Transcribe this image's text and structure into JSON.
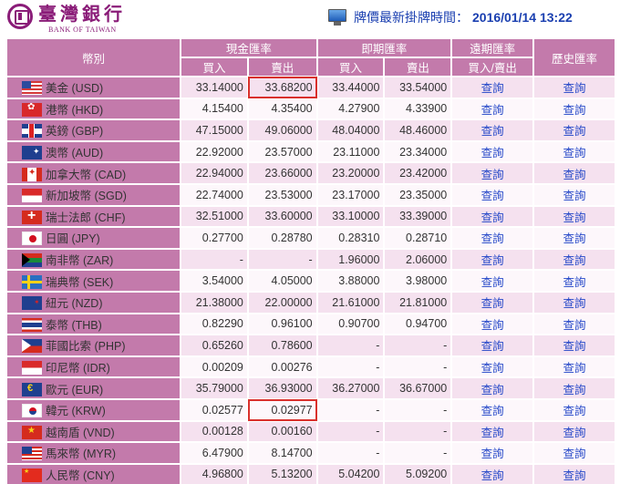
{
  "bank": {
    "name_zh": "臺灣銀行",
    "name_en": "BANK OF TAIWAN"
  },
  "update": {
    "icon": "monitor-icon",
    "label": "牌價最新掛牌時間：",
    "time": "2016/01/14 13:22"
  },
  "table": {
    "headers": {
      "currency": "幣別",
      "cash": "現金匯率",
      "spot": "即期匯率",
      "forward": "遠期匯率",
      "history": "歷史匯率",
      "buy": "買入",
      "sell": "賣出",
      "buy_sell": "買入/賣出"
    },
    "link_label": "查詢",
    "rows": [
      {
        "flag": "usd",
        "currency": "美金 (USD)",
        "cash_buy": "33.14000",
        "cash_sell": "33.68200",
        "spot_buy": "33.44000",
        "spot_sell": "33.54000"
      },
      {
        "flag": "hkd",
        "currency": "港幣 (HKD)",
        "cash_buy": "4.15400",
        "cash_sell": "4.35400",
        "spot_buy": "4.27900",
        "spot_sell": "4.33900"
      },
      {
        "flag": "gbp",
        "currency": "英鎊 (GBP)",
        "cash_buy": "47.15000",
        "cash_sell": "49.06000",
        "spot_buy": "48.04000",
        "spot_sell": "48.46000"
      },
      {
        "flag": "aud",
        "currency": "澳幣 (AUD)",
        "cash_buy": "22.92000",
        "cash_sell": "23.57000",
        "spot_buy": "23.11000",
        "spot_sell": "23.34000"
      },
      {
        "flag": "cad",
        "currency": "加拿大幣 (CAD)",
        "cash_buy": "22.94000",
        "cash_sell": "23.66000",
        "spot_buy": "23.20000",
        "spot_sell": "23.42000"
      },
      {
        "flag": "sgd",
        "currency": "新加坡幣 (SGD)",
        "cash_buy": "22.74000",
        "cash_sell": "23.53000",
        "spot_buy": "23.17000",
        "spot_sell": "23.35000"
      },
      {
        "flag": "chf",
        "currency": "瑞士法郎 (CHF)",
        "cash_buy": "32.51000",
        "cash_sell": "33.60000",
        "spot_buy": "33.10000",
        "spot_sell": "33.39000"
      },
      {
        "flag": "jpy",
        "currency": "日圓 (JPY)",
        "cash_buy": "0.27700",
        "cash_sell": "0.28780",
        "spot_buy": "0.28310",
        "spot_sell": "0.28710"
      },
      {
        "flag": "zar",
        "currency": "南非幣 (ZAR)",
        "cash_buy": "-",
        "cash_sell": "-",
        "spot_buy": "1.96000",
        "spot_sell": "2.06000"
      },
      {
        "flag": "sek",
        "currency": "瑞典幣 (SEK)",
        "cash_buy": "3.54000",
        "cash_sell": "4.05000",
        "spot_buy": "3.88000",
        "spot_sell": "3.98000"
      },
      {
        "flag": "nzd",
        "currency": "紐元 (NZD)",
        "cash_buy": "21.38000",
        "cash_sell": "22.00000",
        "spot_buy": "21.61000",
        "spot_sell": "21.81000"
      },
      {
        "flag": "thb",
        "currency": "泰幣 (THB)",
        "cash_buy": "0.82290",
        "cash_sell": "0.96100",
        "spot_buy": "0.90700",
        "spot_sell": "0.94700"
      },
      {
        "flag": "php",
        "currency": "菲國比索 (PHP)",
        "cash_buy": "0.65260",
        "cash_sell": "0.78600",
        "spot_buy": "-",
        "spot_sell": "-"
      },
      {
        "flag": "idr",
        "currency": "印尼幣 (IDR)",
        "cash_buy": "0.00209",
        "cash_sell": "0.00276",
        "spot_buy": "-",
        "spot_sell": "-"
      },
      {
        "flag": "eur",
        "currency": "歐元 (EUR)",
        "cash_buy": "35.79000",
        "cash_sell": "36.93000",
        "spot_buy": "36.27000",
        "spot_sell": "36.67000"
      },
      {
        "flag": "krw",
        "currency": "韓元 (KRW)",
        "cash_buy": "0.02577",
        "cash_sell": "0.02977",
        "spot_buy": "-",
        "spot_sell": "-"
      },
      {
        "flag": "vnd",
        "currency": "越南盾 (VND)",
        "cash_buy": "0.00128",
        "cash_sell": "0.00160",
        "spot_buy": "-",
        "spot_sell": "-"
      },
      {
        "flag": "myr",
        "currency": "馬來幣 (MYR)",
        "cash_buy": "6.47900",
        "cash_sell": "8.14700",
        "spot_buy": "-",
        "spot_sell": "-"
      },
      {
        "flag": "cny",
        "currency": "人民幣 (CNY)",
        "cash_buy": "4.96800",
        "cash_sell": "5.13200",
        "spot_buy": "5.04200",
        "spot_sell": "5.09200"
      }
    ],
    "highlighted_cells": [
      {
        "row": 0,
        "column": "cash_sell"
      },
      {
        "row": 15,
        "column": "cash_sell"
      }
    ]
  },
  "colors": {
    "header_bg": "#c37aab",
    "row_odd_bg": "#f5e1ef",
    "row_even_bg": "#fdf7fb",
    "link": "#2346c8",
    "update_text": "#1a3fb0",
    "brand": "#8a1c78",
    "highlight_border": "#d9302c"
  }
}
